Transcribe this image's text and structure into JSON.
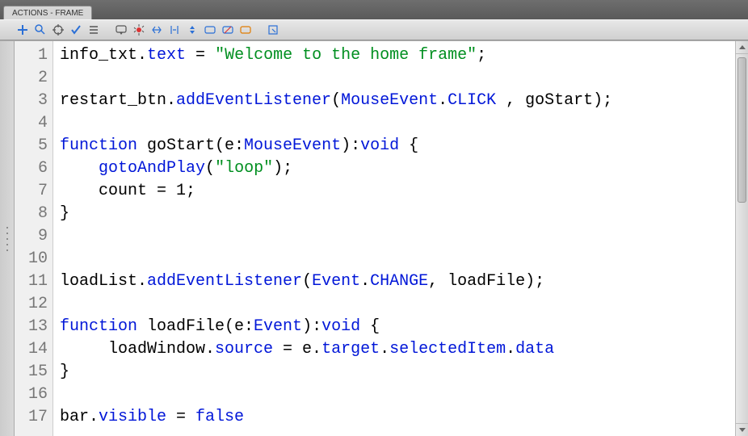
{
  "panel_title": "ACTIONS - FRAME",
  "toolbar": {
    "icons": [
      "add-script-icon",
      "find-icon",
      "target-icon",
      "check-syntax-icon",
      "auto-format-icon",
      "code-hint-icon",
      "debug-icon",
      "collapse-brace-icon",
      "collapse-selection-icon",
      "expand-all-icon",
      "comment-icon",
      "uncomment-icon",
      "flag-icon",
      "pin-script-icon"
    ]
  },
  "code_lines": [
    {
      "n": 1,
      "tokens": [
        [
          "black",
          "info_txt."
        ],
        [
          "blue",
          "text"
        ],
        [
          "black",
          " = "
        ],
        [
          "green",
          "\"Welcome to the home frame\""
        ],
        [
          "black",
          ";"
        ]
      ]
    },
    {
      "n": 2,
      "tokens": []
    },
    {
      "n": 3,
      "tokens": [
        [
          "black",
          "restart_btn."
        ],
        [
          "blue",
          "addEventListener"
        ],
        [
          "black",
          "("
        ],
        [
          "blue",
          "MouseEvent"
        ],
        [
          "black",
          "."
        ],
        [
          "blue",
          "CLICK"
        ],
        [
          "black",
          " , goStart);"
        ]
      ]
    },
    {
      "n": 4,
      "tokens": []
    },
    {
      "n": 5,
      "tokens": [
        [
          "blue",
          "function"
        ],
        [
          "black",
          " goStart(e:"
        ],
        [
          "blue",
          "MouseEvent"
        ],
        [
          "black",
          "):"
        ],
        [
          "blue",
          "void"
        ],
        [
          "black",
          " {"
        ]
      ]
    },
    {
      "n": 6,
      "tokens": [
        [
          "black",
          "    "
        ],
        [
          "blue",
          "gotoAndPlay"
        ],
        [
          "black",
          "("
        ],
        [
          "green",
          "\"loop\""
        ],
        [
          "black",
          ");"
        ]
      ]
    },
    {
      "n": 7,
      "tokens": [
        [
          "black",
          "    count = 1;"
        ]
      ]
    },
    {
      "n": 8,
      "tokens": [
        [
          "black",
          "}"
        ]
      ]
    },
    {
      "n": 9,
      "tokens": []
    },
    {
      "n": 10,
      "tokens": []
    },
    {
      "n": 11,
      "tokens": [
        [
          "black",
          "loadList."
        ],
        [
          "blue",
          "addEventListener"
        ],
        [
          "black",
          "("
        ],
        [
          "blue",
          "Event"
        ],
        [
          "black",
          "."
        ],
        [
          "blue",
          "CHANGE"
        ],
        [
          "black",
          ", loadFile);"
        ]
      ]
    },
    {
      "n": 12,
      "tokens": []
    },
    {
      "n": 13,
      "tokens": [
        [
          "blue",
          "function"
        ],
        [
          "black",
          " loadFile(e:"
        ],
        [
          "blue",
          "Event"
        ],
        [
          "black",
          "):"
        ],
        [
          "blue",
          "void"
        ],
        [
          "black",
          " {"
        ]
      ]
    },
    {
      "n": 14,
      "tokens": [
        [
          "black",
          "     loadWindow."
        ],
        [
          "blue",
          "source"
        ],
        [
          "black",
          " = e."
        ],
        [
          "blue",
          "target"
        ],
        [
          "black",
          "."
        ],
        [
          "blue",
          "selectedItem"
        ],
        [
          "black",
          "."
        ],
        [
          "blue",
          "data"
        ]
      ]
    },
    {
      "n": 15,
      "tokens": [
        [
          "black",
          "}"
        ]
      ]
    },
    {
      "n": 16,
      "tokens": []
    },
    {
      "n": 17,
      "tokens": [
        [
          "black",
          "bar."
        ],
        [
          "blue",
          "visible"
        ],
        [
          "black",
          " = "
        ],
        [
          "blue",
          "false"
        ]
      ]
    }
  ]
}
